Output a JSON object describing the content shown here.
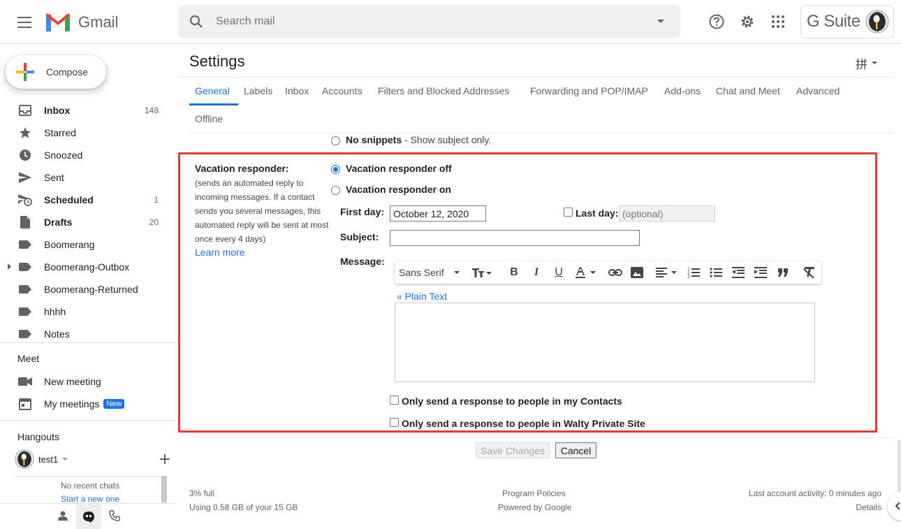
{
  "header": {
    "app_name": "Gmail",
    "search_placeholder": "Search mail",
    "gsuite_label": "G Suite"
  },
  "sidebar": {
    "compose_label": "Compose",
    "items": [
      {
        "label": "Inbox",
        "count": "148",
        "bold": true,
        "icon": "inbox-icon"
      },
      {
        "label": "Starred",
        "count": "",
        "bold": false,
        "icon": "star-icon"
      },
      {
        "label": "Snoozed",
        "count": "",
        "bold": false,
        "icon": "clock-icon"
      },
      {
        "label": "Sent",
        "count": "",
        "bold": false,
        "icon": "send-icon"
      },
      {
        "label": "Scheduled",
        "count": "1",
        "bold": true,
        "icon": "scheduled-send-icon"
      },
      {
        "label": "Drafts",
        "count": "20",
        "bold": true,
        "icon": "draft-icon"
      },
      {
        "label": "Boomerang",
        "count": "",
        "bold": false,
        "icon": "label-icon"
      },
      {
        "label": "Boomerang-Outbox",
        "count": "",
        "bold": false,
        "icon": "label-icon"
      },
      {
        "label": "Boomerang-Returned",
        "count": "",
        "bold": false,
        "icon": "label-icon"
      },
      {
        "label": "hhhh",
        "count": "",
        "bold": false,
        "icon": "label-icon"
      },
      {
        "label": "Notes",
        "count": "",
        "bold": false,
        "icon": "label-icon"
      }
    ],
    "meet": {
      "title": "Meet",
      "new_meeting": "New meeting",
      "my_meetings": "My meetings",
      "new_badge": "New"
    },
    "hangouts": {
      "title": "Hangouts",
      "user": "test1",
      "no_recent": "No recent chats",
      "start_new": "Start a new one"
    }
  },
  "settings": {
    "title": "Settings",
    "tabs": [
      "General",
      "Labels",
      "Inbox",
      "Accounts",
      "Filters and Blocked Addresses",
      "Forwarding and POP/IMAP",
      "Add-ons",
      "Chat and Meet",
      "Advanced",
      "Offline"
    ],
    "active_tab": "General",
    "no_snippets_bold": "No snippets",
    "no_snippets_rest": " - Show subject only.",
    "vacation": {
      "title": "Vacation responder:",
      "description": "(sends an automated reply to incoming messages. If a contact sends you several messages, this automated reply will be sent at most once every 4 days)",
      "learn_more": "Learn more",
      "off_label": "Vacation responder off",
      "on_label": "Vacation responder on",
      "selected": "off",
      "first_day_label": "First day:",
      "first_day_value": "October 12, 2020",
      "last_day_label": "Last day:",
      "last_day_placeholder": "(optional)",
      "subject_label": "Subject:",
      "subject_value": "",
      "message_label": "Message:",
      "font_name": "Sans Serif",
      "plain_text_link": "« Plain Text",
      "contacts_only": "Only send a response to people in my Contacts",
      "domain_only": "Only send a response to people in Walty Private Site"
    },
    "save_label": "Save Changes",
    "cancel_label": "Cancel"
  },
  "footer": {
    "storage_percent": "3% full",
    "storage_detail": "Using 0.58 GB of your 15 GB",
    "program_policies": "Program Policies",
    "powered_by": "Powered by Google",
    "last_activity": "Last account activity: 0 minutes ago",
    "details": "Details"
  },
  "colors": {
    "accent": "#1a73e8",
    "highlight": "#e53935",
    "gmail_red": "#ea4335"
  }
}
